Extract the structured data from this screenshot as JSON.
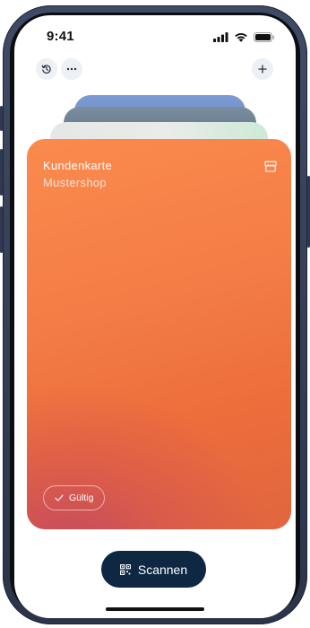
{
  "status_bar": {
    "time": "9:41"
  },
  "toolbar": {
    "history_icon": "history-icon",
    "more_icon": "more-icon",
    "add_icon": "plus-icon"
  },
  "card": {
    "title": "Kundenkarte",
    "subtitle": "Mustershop",
    "brand_icon": "store-icon",
    "status_label": "Gültig",
    "colors": {
      "top": "#fb8a4d",
      "bottom_accent": "#be4664"
    }
  },
  "stack_colors": [
    "#6f8fc7",
    "#5f7689",
    "#e7eae6",
    "#cfe9d8"
  ],
  "scan_button": {
    "label": "Scannen",
    "icon": "qr-code-icon",
    "color": "#0e2844"
  }
}
